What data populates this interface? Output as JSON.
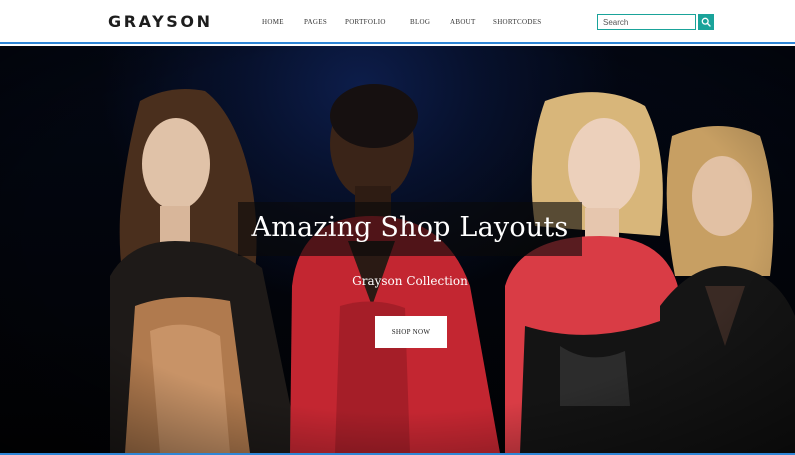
{
  "brand": {
    "logo_text": "GRAYSON"
  },
  "nav": {
    "items": [
      {
        "label": "HOME"
      },
      {
        "label": "PAGES"
      },
      {
        "label": "PORTFOLIO"
      },
      {
        "label": "BLOG"
      },
      {
        "label": "ABOUT"
      },
      {
        "label": "SHORTCODES"
      }
    ]
  },
  "search": {
    "placeholder": "Search",
    "icon": "search-icon"
  },
  "hero": {
    "title": "Amazing Shop Layouts",
    "subtitle": "Grayson Collection",
    "button_label": "SHOP NOW"
  },
  "colors": {
    "accent": "#1aa39a",
    "header_rule": "#2f86d6",
    "hero_bg": "#020409",
    "title_panel": "#0a0a0a"
  }
}
